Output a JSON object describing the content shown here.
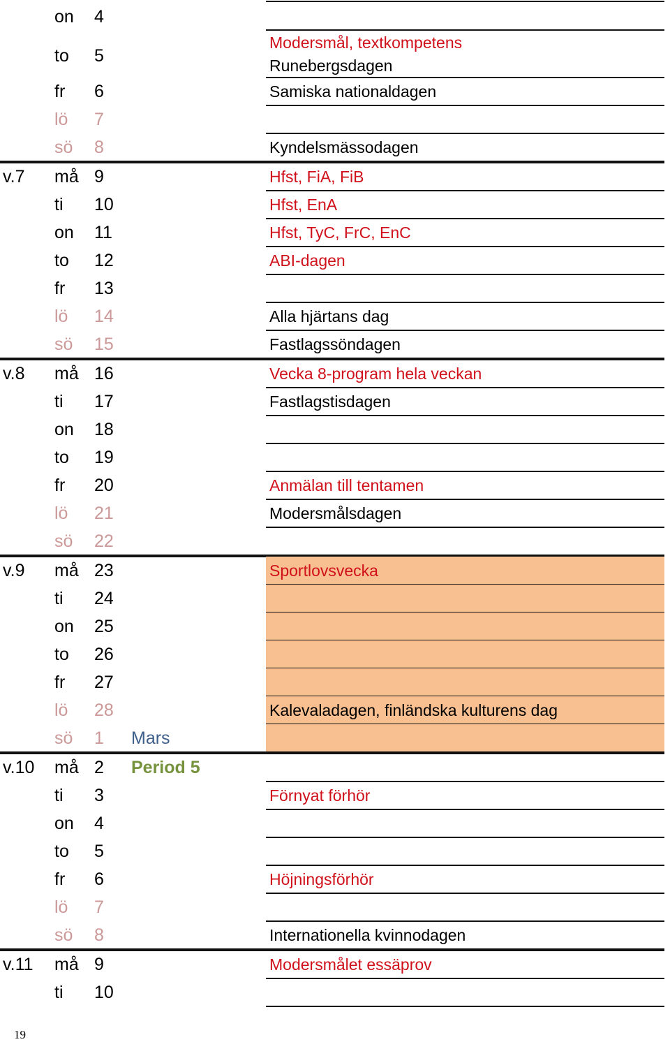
{
  "colors": {
    "weekend": "#CC9999",
    "event_red": "#D0111B",
    "month_blue": "#3E5F8A",
    "period_green": "#76923C",
    "holiday_fill": "#F8BF90"
  },
  "rows": [
    {
      "week": "",
      "day": "on",
      "date": "4",
      "weekend": false,
      "extra": "",
      "notes": []
    },
    {
      "week": "",
      "day": "to",
      "date": "5",
      "weekend": false,
      "extra": "",
      "notes": [
        {
          "text": "Modersmål, textkompetens",
          "red": true
        },
        {
          "text": "Runebergsdagen",
          "red": false
        }
      ]
    },
    {
      "week": "",
      "day": "fr",
      "date": "6",
      "weekend": false,
      "extra": "",
      "notes": [
        {
          "text": "Samiska nationaldagen",
          "red": false
        }
      ]
    },
    {
      "week": "",
      "day": "lö",
      "date": "7",
      "weekend": true,
      "extra": "",
      "notes": []
    },
    {
      "week": "",
      "day": "sö",
      "date": "8",
      "weekend": true,
      "extra": "",
      "notes": [
        {
          "text": "Kyndelsmässodagen",
          "red": false
        }
      ]
    },
    {
      "week": "v.7",
      "day": "må",
      "date": "9",
      "weekend": false,
      "extra": "",
      "notes": [
        {
          "text": "Hfst, FiA, FiB",
          "red": true
        }
      ]
    },
    {
      "week": "",
      "day": "ti",
      "date": "10",
      "weekend": false,
      "extra": "",
      "notes": [
        {
          "text": "Hfst, EnA",
          "red": true
        }
      ]
    },
    {
      "week": "",
      "day": "on",
      "date": "11",
      "weekend": false,
      "extra": "",
      "notes": [
        {
          "text": "Hfst, TyC, FrC, EnC",
          "red": true
        }
      ]
    },
    {
      "week": "",
      "day": "to",
      "date": "12",
      "weekend": false,
      "extra": "",
      "notes": [
        {
          "text": "ABI-dagen",
          "red": true
        }
      ]
    },
    {
      "week": "",
      "day": "fr",
      "date": "13",
      "weekend": false,
      "extra": "",
      "notes": []
    },
    {
      "week": "",
      "day": "lö",
      "date": "14",
      "weekend": true,
      "extra": "",
      "notes": [
        {
          "text": "Alla hjärtans dag",
          "red": false
        }
      ]
    },
    {
      "week": "",
      "day": "sö",
      "date": "15",
      "weekend": true,
      "extra": "",
      "notes": [
        {
          "text": "Fastlagssöndagen",
          "red": false
        }
      ]
    },
    {
      "week": "v.8",
      "day": "må",
      "date": "16",
      "weekend": false,
      "extra": "",
      "notes": [
        {
          "text": "Vecka 8-program hela veckan",
          "red": true
        }
      ]
    },
    {
      "week": "",
      "day": "ti",
      "date": "17",
      "weekend": false,
      "extra": "",
      "notes": [
        {
          "text": "Fastlagstisdagen",
          "red": false
        }
      ]
    },
    {
      "week": "",
      "day": "on",
      "date": "18",
      "weekend": false,
      "extra": "",
      "notes": []
    },
    {
      "week": "",
      "day": "to",
      "date": "19",
      "weekend": false,
      "extra": "",
      "notes": []
    },
    {
      "week": "",
      "day": "fr",
      "date": "20",
      "weekend": false,
      "extra": "",
      "notes": [
        {
          "text": "Anmälan till tentamen",
          "red": true
        }
      ]
    },
    {
      "week": "",
      "day": "lö",
      "date": "21",
      "weekend": true,
      "extra": "",
      "notes": [
        {
          "text": "Modersmålsdagen",
          "red": false
        }
      ]
    },
    {
      "week": "",
      "day": "sö",
      "date": "22",
      "weekend": true,
      "extra": "",
      "notes": []
    },
    {
      "week": "v.9",
      "day": "må",
      "date": "23",
      "weekend": false,
      "extra": "",
      "shade": true,
      "notes": [
        {
          "text": "Sportlovsvecka",
          "red": true
        }
      ]
    },
    {
      "week": "",
      "day": "ti",
      "date": "24",
      "weekend": false,
      "extra": "",
      "shade": true,
      "notes": []
    },
    {
      "week": "",
      "day": "on",
      "date": "25",
      "weekend": false,
      "extra": "",
      "shade": true,
      "notes": []
    },
    {
      "week": "",
      "day": "to",
      "date": "26",
      "weekend": false,
      "extra": "",
      "shade": true,
      "notes": []
    },
    {
      "week": "",
      "day": "fr",
      "date": "27",
      "weekend": false,
      "extra": "",
      "shade": true,
      "notes": []
    },
    {
      "week": "",
      "day": "lö",
      "date": "28",
      "weekend": true,
      "extra": "",
      "shade": true,
      "notes": [
        {
          "text": "Kalevaladagen, finländska kulturens dag",
          "red": false
        }
      ]
    },
    {
      "week": "",
      "day": "sö",
      "date": "1",
      "weekend": true,
      "extra": "Mars",
      "extra_style": "blue",
      "shade": true,
      "notes": []
    },
    {
      "week": "v.10",
      "day": "må",
      "date": "2",
      "weekend": false,
      "extra": "Period 5",
      "extra_style": "green",
      "notes": []
    },
    {
      "week": "",
      "day": "ti",
      "date": "3",
      "weekend": false,
      "extra": "",
      "notes": [
        {
          "text": "Förnyat förhör",
          "red": true
        }
      ]
    },
    {
      "week": "",
      "day": "on",
      "date": "4",
      "weekend": false,
      "extra": "",
      "notes": []
    },
    {
      "week": "",
      "day": "to",
      "date": "5",
      "weekend": false,
      "extra": "",
      "notes": []
    },
    {
      "week": "",
      "day": "fr",
      "date": "6",
      "weekend": false,
      "extra": "",
      "notes": [
        {
          "text": "Höjningsförhör",
          "red": true
        }
      ]
    },
    {
      "week": "",
      "day": "lö",
      "date": "7",
      "weekend": true,
      "extra": "",
      "notes": []
    },
    {
      "week": "",
      "day": "sö",
      "date": "8",
      "weekend": true,
      "extra": "",
      "notes": [
        {
          "text": "Internationella kvinnodagen",
          "red": false
        }
      ]
    },
    {
      "week": "v.11",
      "day": "må",
      "date": "9",
      "weekend": false,
      "extra": "",
      "notes": [
        {
          "text": "Modersmålet essäprov",
          "red": true
        }
      ]
    },
    {
      "week": "",
      "day": "ti",
      "date": "10",
      "weekend": false,
      "extra": "",
      "notes": []
    }
  ],
  "page_number": "19"
}
